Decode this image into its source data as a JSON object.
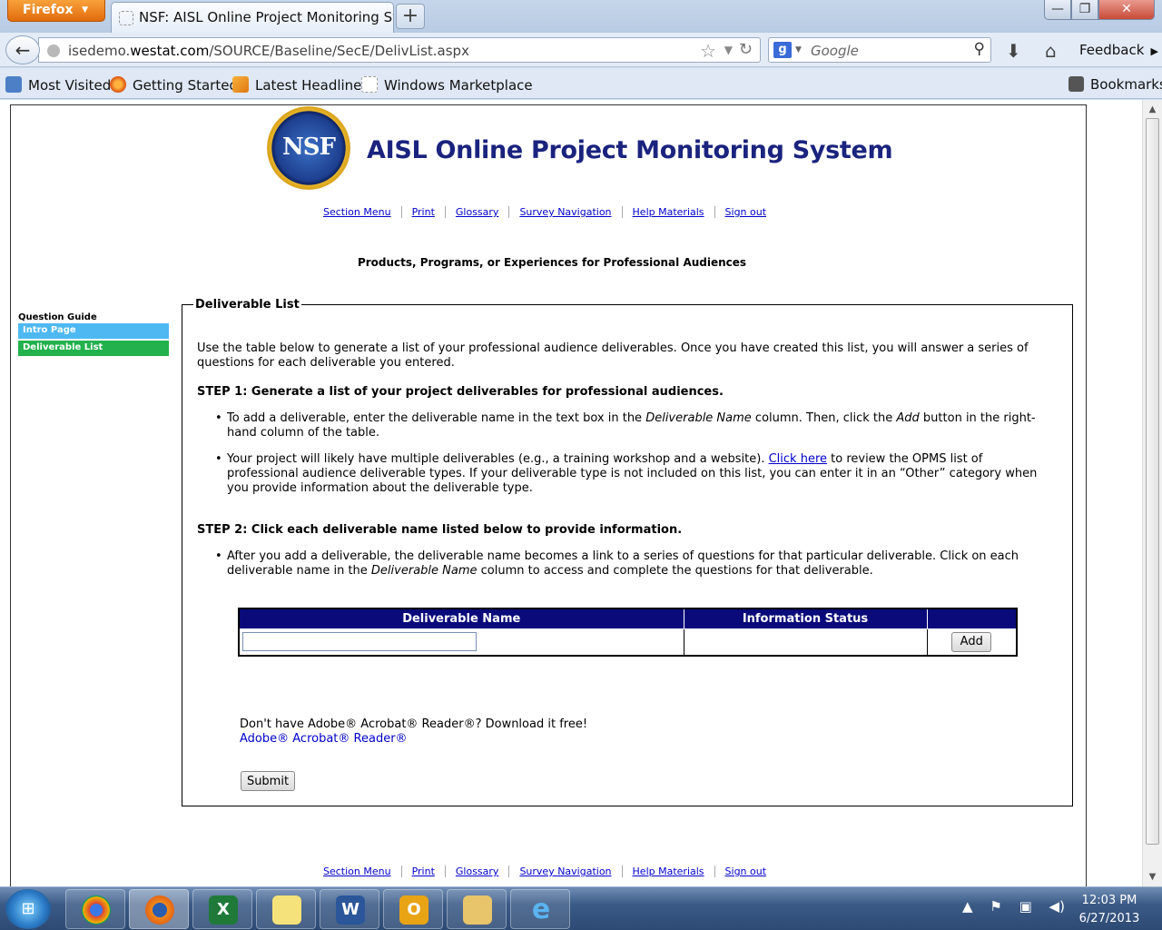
{
  "browser": {
    "app_button": "Firefox",
    "tab_title": "NSF: AISL Online Project Monitoring Syst...",
    "new_tab": "+",
    "url_prefix": "isedemo.",
    "url_domain": "westat.com",
    "url_path": "/SOURCE/Baseline/SecE/DelivList.aspx",
    "search_placeholder": "Google",
    "feedback_label": "Feedback",
    "bookmarks": [
      {
        "label": "Most Visited",
        "icon": "most-visited-icon"
      },
      {
        "label": "Getting Started",
        "icon": "firefox-icon"
      },
      {
        "label": "Latest Headlines",
        "icon": "rss-icon"
      },
      {
        "label": "Windows Marketplace",
        "icon": "blank-page-icon"
      }
    ],
    "bookmarks_menu": "Bookmarks"
  },
  "page": {
    "logo_text": "NSF",
    "site_title": "AISL Online Project Monitoring System",
    "nav_links": [
      "Section Menu",
      "Print",
      "Glossary",
      "Survey Navigation",
      "Help Materials",
      "Sign out"
    ],
    "section_title": "Products, Programs, or Experiences for Professional Audiences",
    "question_guide": {
      "label": "Question Guide",
      "items": [
        "Intro Page",
        "Deliverable List"
      ]
    },
    "fieldset": {
      "legend": "Deliverable List",
      "intro": "Use the table below to generate a list of your professional audience deliverables. Once you have created this list, you will answer a series of questions for each deliverable you entered.",
      "step1": "STEP 1: Generate a list of your project deliverables for professional audiences.",
      "step1_b1_a": "To add a deliverable, enter the deliverable name in the text box in the ",
      "step1_b1_em1": "Deliverable Name",
      "step1_b1_b": " column. Then, click the ",
      "step1_b1_em2": "Add",
      "step1_b1_c": " button in the right-hand column of the table.",
      "step1_b2_a": "Your project will likely have multiple deliverables (e.g., a training workshop and a website). ",
      "step1_b2_link": "Click here",
      "step1_b2_b": " to review the OPMS list of professional audience deliverable types. If your deliverable type is not included on this list, you can enter it in an “Other” category when you provide information about the deliverable type.",
      "step2": "STEP 2: Click each deliverable name listed below to provide information.",
      "step2_b1_a": "After you add a deliverable, the deliverable name becomes a link to a series of questions for that particular deliverable. Click on each deliverable name in the ",
      "step2_b1_em": "Deliverable Name",
      "step2_b1_b": " column to access and complete the questions for that deliverable."
    },
    "table": {
      "headers": [
        "Deliverable Name",
        "Information Status",
        ""
      ],
      "input_value": "",
      "add_label": "Add"
    },
    "adobe_text": "Don't have Adobe® Acrobat® Reader®? Download it free!",
    "adobe_link": "Adobe® Acrobat® Reader®",
    "submit_label": "Submit"
  },
  "taskbar": {
    "apps": [
      "chrome",
      "firefox",
      "excel",
      "sticky-notes",
      "word",
      "outlook",
      "explorer",
      "internet-explorer"
    ],
    "time": "12:03 PM",
    "date": "6/27/2013"
  }
}
